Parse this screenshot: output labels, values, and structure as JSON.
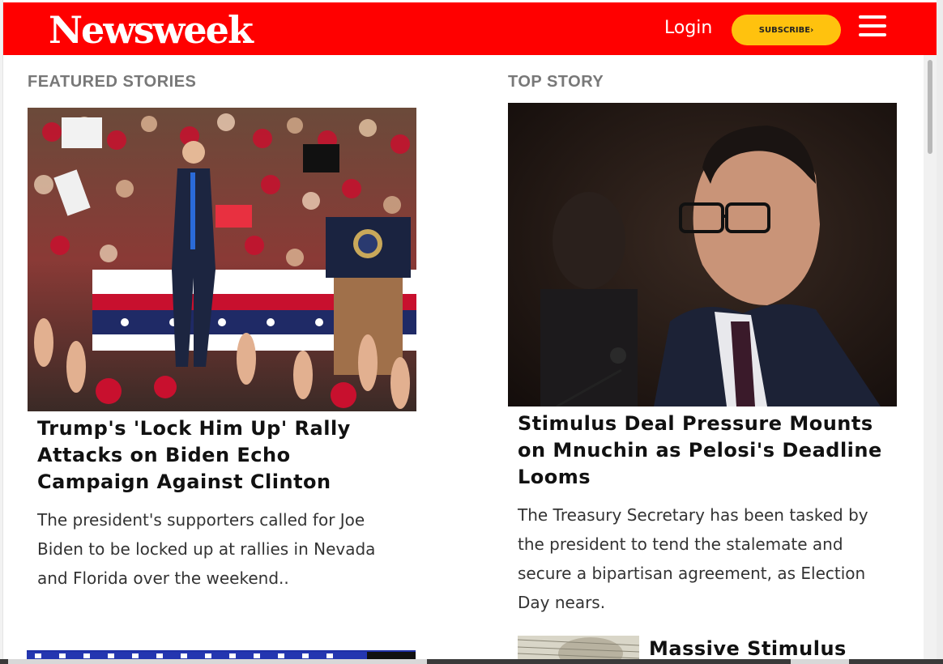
{
  "header": {
    "logo": "Newsweek",
    "login_label": "Login",
    "subscribe_label": "SUBSCRIBE›",
    "brand_color": "#ff0000",
    "subscribe_color": "#ffc20e"
  },
  "featured": {
    "section_title": "FEATURED STORIES",
    "headline": "Trump's 'Lock Him Up' Rally Attacks on Biden Echo Campaign Against Clinton",
    "dek": "The president's supporters called for Joe Biden to be locked up at rallies in Nevada and Florida over the weekend.."
  },
  "top_story": {
    "section_title": "TOP STORY",
    "headline": "Stimulus Deal Pressure Mounts on Mnuchin as Pelosi's Deadline Looms",
    "dek": "The Treasury Secretary has been tasked by the president to tend the stalemate and secure a bipartisan agreement, as Election Day nears.",
    "next_headline_partial": "Massive Stimulus"
  },
  "icons": {
    "menu": "hamburger-menu-icon"
  }
}
